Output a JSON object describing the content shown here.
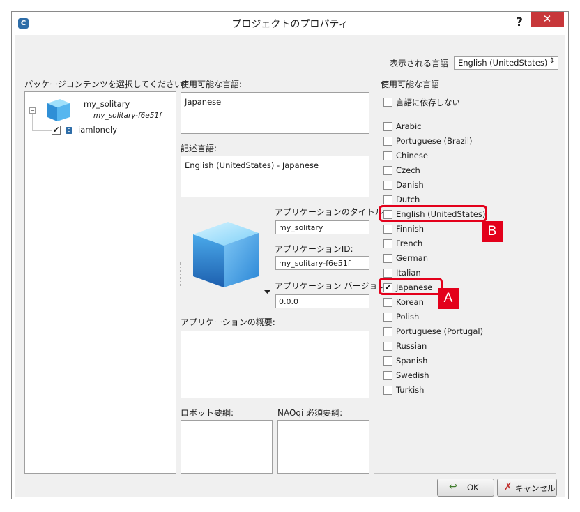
{
  "window": {
    "title": "プロジェクトのプロパティ",
    "help_label": "?",
    "close_label": "✕"
  },
  "top": {
    "display_language_label": "表示される言語",
    "display_language_value": "English (UnitedStates)"
  },
  "left": {
    "package_label": "パッケージコンテンツを選択してください",
    "project_name": "my_solitary",
    "project_id": "my_solitary-f6e51f",
    "item_label": "iamlonely",
    "item_checked": true
  },
  "middle": {
    "available_languages_label": "使用可能な言語:",
    "available_languages_value": "Japanese",
    "description_language_label": "記述言語:",
    "description_language_value": "English (UnitedStates) - Japanese",
    "app_title_label": "アプリケーションのタイトル:",
    "app_title_value": "my_solitary",
    "app_id_label": "アプリケーションID:",
    "app_id_value": "my_solitary-f6e51f",
    "app_version_label": "アプリケーション バージョン:",
    "app_version_value": "0.0.0",
    "app_summary_label": "アプリケーションの概要:",
    "robot_req_label": "ロボット要綱:",
    "naoqi_req_label": "NAOqi 必須要綱:"
  },
  "languages": {
    "group_label": "使用可能な言語",
    "independent_label": "言語に依存しない",
    "independent_checked": false,
    "items": [
      {
        "label": "Arabic",
        "checked": false
      },
      {
        "label": "Portuguese (Brazil)",
        "checked": false
      },
      {
        "label": "Chinese",
        "checked": false
      },
      {
        "label": "Czech",
        "checked": false
      },
      {
        "label": "Danish",
        "checked": false
      },
      {
        "label": "Dutch",
        "checked": false
      },
      {
        "label": "English (UnitedStates)",
        "checked": false
      },
      {
        "label": "Finnish",
        "checked": false
      },
      {
        "label": "French",
        "checked": false
      },
      {
        "label": "German",
        "checked": false
      },
      {
        "label": "Italian",
        "checked": false
      },
      {
        "label": "Japanese",
        "checked": true
      },
      {
        "label": "Korean",
        "checked": false
      },
      {
        "label": "Polish",
        "checked": false
      },
      {
        "label": "Portuguese (Portugal)",
        "checked": false
      },
      {
        "label": "Russian",
        "checked": false
      },
      {
        "label": "Spanish",
        "checked": false
      },
      {
        "label": "Swedish",
        "checked": false
      },
      {
        "label": "Turkish",
        "checked": false
      }
    ]
  },
  "annotations": {
    "a_label": "A",
    "b_label": "B",
    "color": "#e3001b"
  },
  "buttons": {
    "ok_label": "OK",
    "cancel_label": "キャンセル"
  },
  "icons": {
    "app": "app-icon",
    "help": "help-icon",
    "close": "close-icon",
    "dropdown": "chevron-updown-icon",
    "ok": "ok-arrow-icon",
    "cancel": "cancel-x-icon"
  }
}
